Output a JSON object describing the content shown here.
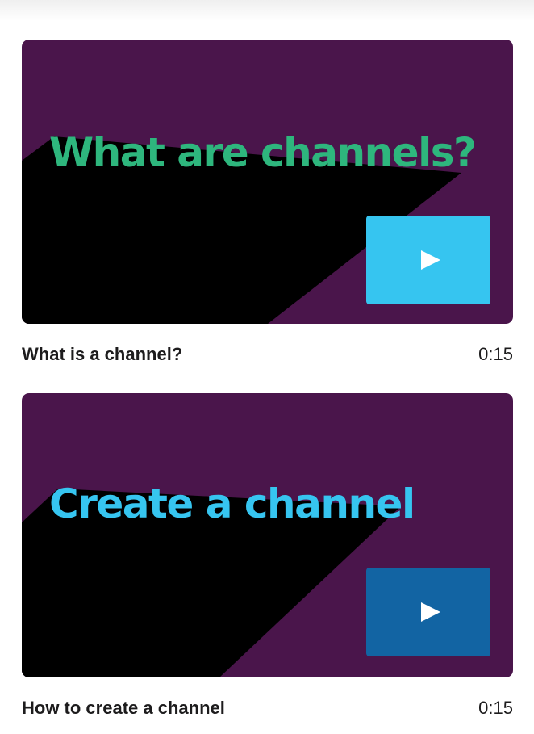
{
  "colors": {
    "thumbnail_bg": "#4a154b",
    "shadow": "#000000",
    "green_text": "#2eb67d",
    "blue_text": "#36c5f0",
    "play_light_blue": "#36c5f0",
    "play_dark_blue": "#1264a3",
    "caption_text": "#1d1c1d"
  },
  "videos": [
    {
      "thumbnail_text": "What are channels?",
      "title": "What is a channel?",
      "duration": "0:15",
      "play_icon": "play-icon"
    },
    {
      "thumbnail_text": "Create a channel",
      "title": "How to create a channel",
      "duration": "0:15",
      "play_icon": "play-icon"
    }
  ]
}
